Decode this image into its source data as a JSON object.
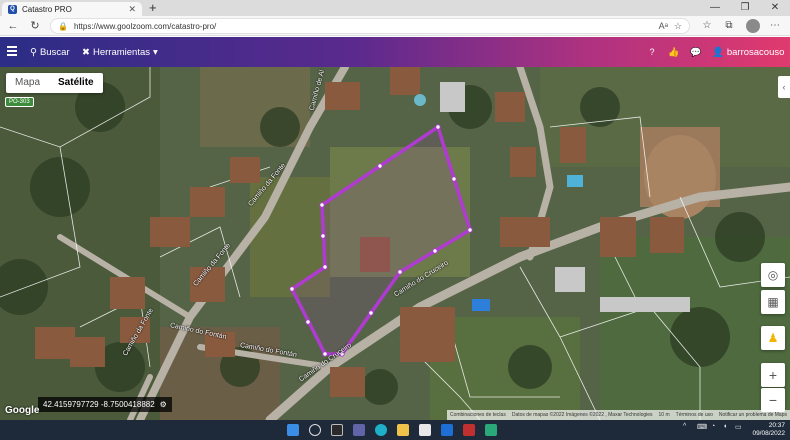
{
  "browser": {
    "tab_title": "Catastro PRO",
    "tab_favicon_icon": "q-logo-icon",
    "new_tab_label": "+",
    "url": "https://www.goolzoom.com/catastro-pro/",
    "back_icon": "arrow-left-icon",
    "refresh_icon": "refresh-icon"
  },
  "header": {
    "buscar_label": "Buscar",
    "herramientas_label": "Herramientas",
    "user_label": "barrosacouso"
  },
  "map": {
    "type_options": [
      "Mapa",
      "Satélite"
    ],
    "selected_type": "Satélite",
    "road_badge": "PO-303",
    "coordinates": "42.4159797729 -8.7500418882",
    "google_label": "Google",
    "attribution": [
      "Combinaciones de teclas",
      "Datos de mapas ©2022 Imágenes ©2022 , Maxar Technologies",
      "10 m",
      "Términos de uso",
      "Notificar un problema de Maps"
    ],
    "street_labels": [
      "Camiño da Fonte",
      "Camiño da Fonte",
      "Camiño do Cruceiro",
      "Camiño do Cruceiro",
      "Camiño do Fontán",
      "Camiño do Fontán",
      "Camiño da Fonte",
      "Camiño de Al"
    ],
    "parcel_color": "#b03bd1"
  },
  "taskbar": {
    "time": "20:37",
    "date": "09/08/2022"
  }
}
